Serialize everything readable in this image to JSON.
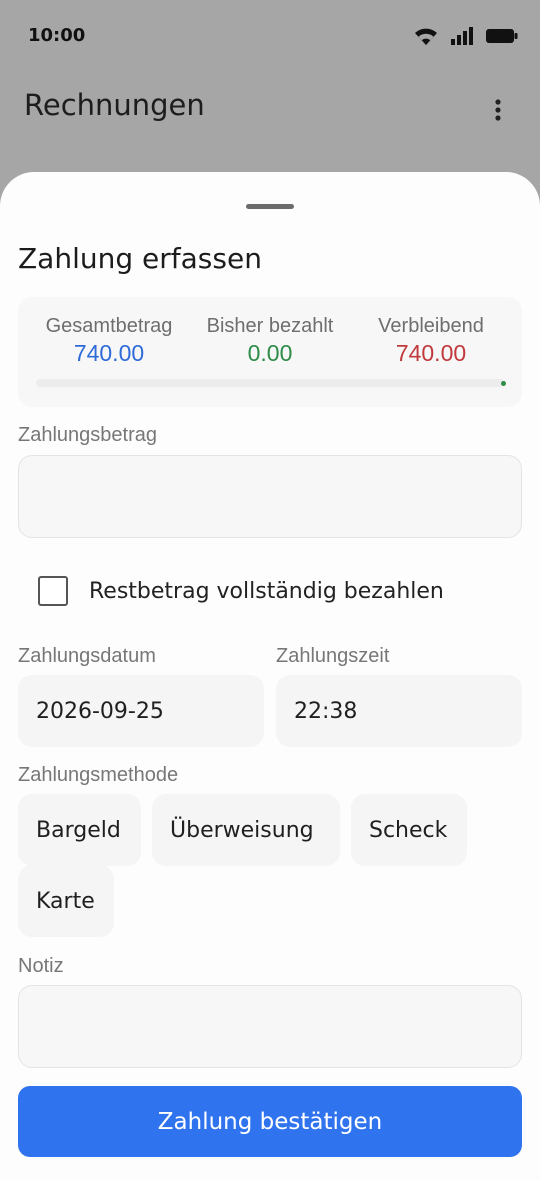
{
  "status_bar": {
    "time": "10:00",
    "icons": [
      "wifi-icon",
      "signal-icon",
      "battery-icon"
    ]
  },
  "app_bar": {
    "title": "Rechnungen",
    "menu_icon": "more-vert-icon"
  },
  "sheet": {
    "title": "Zahlung erfassen",
    "summary": {
      "total": {
        "label": "Gesamtbetrag",
        "value": "740.00",
        "color": "#2e6bd8"
      },
      "paid": {
        "label": "Bisher bezahlt",
        "value": "0.00",
        "color": "#2e8b48"
      },
      "remaining": {
        "label": "Verbleibend",
        "value": "740.00",
        "color": "#c0393b"
      },
      "progress_fraction": 0
    },
    "amount": {
      "label": "Zahlungsbetrag",
      "value": "",
      "placeholder": ""
    },
    "pay_full": {
      "label": "Restbetrag vollständig bezahlen",
      "checked": false
    },
    "date": {
      "label": "Zahlungsdatum",
      "value": "2026-09-25"
    },
    "time": {
      "label": "Zahlungszeit",
      "value": "22:38"
    },
    "method": {
      "label": "Zahlungsmethode",
      "options": [
        "Bargeld",
        "Überweisung",
        "Scheck",
        "Karte"
      ]
    },
    "note": {
      "label": "Notiz",
      "value": "",
      "placeholder": ""
    },
    "confirm_label": "Zahlung bestätigen"
  },
  "colors": {
    "accent": "#2f73ee",
    "scrim": "#a6a6a6"
  }
}
